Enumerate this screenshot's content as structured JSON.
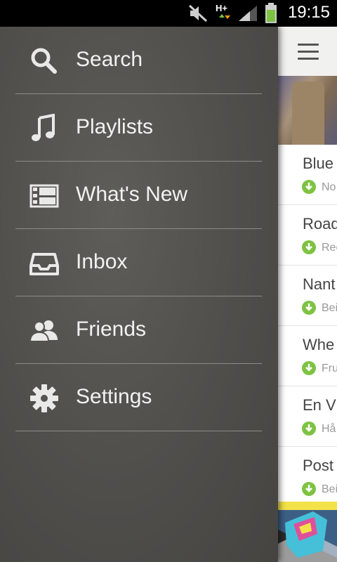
{
  "status_bar": {
    "time": "19:15",
    "network": "H+",
    "icons": [
      "mute-icon",
      "network-hplus-icon",
      "signal-icon",
      "battery-icon"
    ]
  },
  "drawer": {
    "items": [
      {
        "label": "Search",
        "icon": "search-icon"
      },
      {
        "label": "Playlists",
        "icon": "music-note-icon"
      },
      {
        "label": "What's New",
        "icon": "film-icon"
      },
      {
        "label": "Inbox",
        "icon": "inbox-icon"
      },
      {
        "label": "Friends",
        "icon": "friends-icon"
      },
      {
        "label": "Settings",
        "icon": "gear-icon"
      }
    ]
  },
  "content": {
    "tracks": [
      {
        "title": "Blue",
        "subtitle": "No"
      },
      {
        "title": "Road",
        "subtitle": "Rec"
      },
      {
        "title": "Nant",
        "subtitle": "Bei"
      },
      {
        "title": "Whe",
        "subtitle": "Fru"
      },
      {
        "title": "En V",
        "subtitle": "Hå"
      },
      {
        "title": "Post",
        "subtitle": "Bei"
      }
    ]
  },
  "colors": {
    "drawer_bg": "#51504c",
    "drawer_text": "#f2f2f0",
    "divider": "#8d8c88",
    "download_green": "#7ec242"
  }
}
